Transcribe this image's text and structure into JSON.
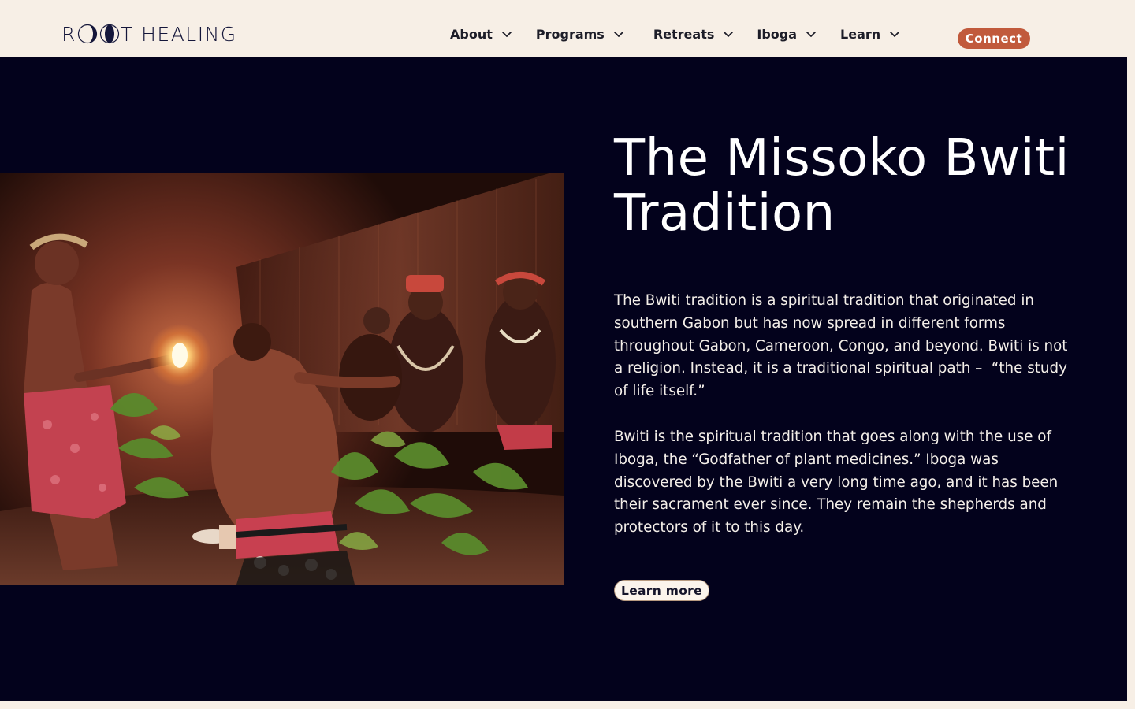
{
  "header": {
    "logo": {
      "part1": "R",
      "part2": "T HEALING"
    },
    "nav": [
      {
        "label": "About"
      },
      {
        "label": "Programs"
      },
      {
        "label": "Retreats"
      },
      {
        "label": "Iboga"
      },
      {
        "label": "Learn"
      }
    ],
    "connect_label": "Connect"
  },
  "hero": {
    "title": "The Missoko Bwiti Tradition",
    "paragraphs": [
      "The Bwiti tradition is a spiritual tradition that originated in southern Gabon but has now spread in different forms throughout Gabon, Cameroon, Congo, and beyond. Bwiti is not a religion. Instead, it is a traditional spiritual path –  “the study of life itself.”",
      "Bwiti is the spiritual tradition that goes along with the use of Iboga, the “Godfather of plant medicines.” Iboga was discovered by the Bwiti a very long time ago, and it has been their sacrament ever since. They remain the shepherds and protectors of it to this day."
    ],
    "learn_more_label": "Learn more"
  },
  "colors": {
    "header_bg": "#f7efe6",
    "hero_bg": "#03021c",
    "accent": "#c15a3c",
    "text_dark": "#1d1d28",
    "text_light": "#ffffff"
  },
  "icons": {
    "logo_moons": [
      "moon-phase-icon",
      "moon-phase-icon"
    ],
    "nav_chevron": "chevron-down-icon"
  }
}
